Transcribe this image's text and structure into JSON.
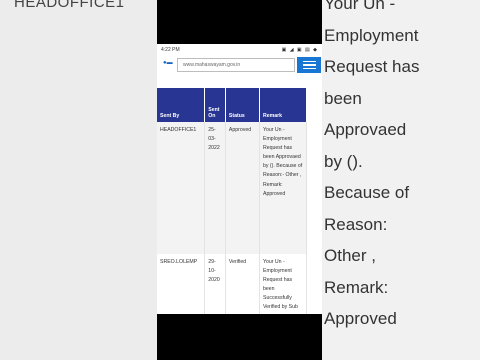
{
  "background": {
    "left_text": "HEADOFFICE1",
    "right_lines": [
      "Your Un -",
      "Employment",
      "Request has",
      "been",
      "Approvaed",
      "by ().",
      "Because of",
      "Reason:",
      "Other ,",
      "Remark:",
      "Approved"
    ]
  },
  "status_bar": {
    "time": "4:22 PM",
    "icons": "▣ ◢ ▣ ▤ ◆"
  },
  "browser": {
    "url": "www.mahaswayam.gov.in"
  },
  "table": {
    "headers": [
      "Sent By",
      "Sent On",
      "Status",
      "Remark"
    ],
    "rows": [
      {
        "sent_by": "HEADOFFICE1",
        "sent_on": "25-03-2022",
        "status": "Approved",
        "remark": "Your Un - Employment Request has been Approvaed by (). Because of Reason:- Other , Remark: Approved"
      },
      {
        "sent_by": "SREO.LOLEMP",
        "sent_on": "29-10-2020",
        "status": "Verified",
        "remark": "Your Un - Employment Request has been Successfully Verified by Sub"
      }
    ]
  },
  "colors": {
    "header_bg": "#283593",
    "menu_button": "#1976d2"
  }
}
